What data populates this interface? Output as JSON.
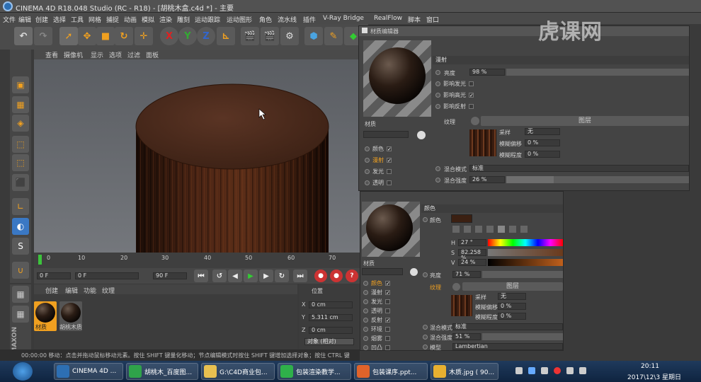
{
  "title": "CINEMA 4D R18.048 Studio (RC - R18) - [胡桃木盒.c4d *] - 主要",
  "menu": [
    "文件",
    "编辑",
    "创建",
    "选择",
    "工具",
    "网格",
    "捕捉",
    "动画",
    "模拟",
    "渲染",
    "雕刻",
    "运动跟踪",
    "运动图形",
    "角色",
    "流水线",
    "插件",
    "V-Ray Bridge",
    "RealFlow",
    "脚本",
    "窗口"
  ],
  "watermark": "虎课网",
  "viewport_menu": [
    "查看",
    "摄像机",
    "显示",
    "选项",
    "过滤",
    "面板"
  ],
  "timeline": {
    "ticks": [
      "0",
      "10",
      "20",
      "30",
      "40",
      "50",
      "60",
      "70"
    ],
    "start": "0 F",
    "min": "0 F",
    "max": "90 F",
    "end": "90 F"
  },
  "material_manager": {
    "menu": [
      "创建",
      "编辑",
      "功能",
      "纹理"
    ],
    "materials": [
      "材质",
      "胡桃木质"
    ]
  },
  "coords": {
    "header": "位置",
    "x": "0 cm",
    "y": "5.311 cm",
    "z": "0 cm",
    "mode": "对象 (相对)"
  },
  "status": "00:00:00    移动：点击并拖动鼠标移动元素。按住 SHIFT 键量化移动；节点编辑模式时按住 SHIFT 键增加选择对象；按住 CTRL 键",
  "editor1": {
    "title": "材质编辑器",
    "name": "材质",
    "channels": [
      {
        "label": "颜色",
        "checked": true
      },
      {
        "label": "漫射",
        "checked": true
      },
      {
        "label": "发光",
        "checked": false
      },
      {
        "label": "透明",
        "checked": false
      },
      {
        "label": "反射",
        "checked": true
      }
    ],
    "section": "漫射",
    "brightness_label": "亮度",
    "brightness": "98 %",
    "affect": [
      "影响发光",
      "影响高光",
      "影响反射"
    ],
    "texture_label": "纹理",
    "layer_button": "图层",
    "sampling_label": "采样",
    "sampling": "无",
    "blur_offset_label": "模糊偏移",
    "blur_offset": "0 %",
    "blur_scale_label": "模糊程度",
    "blur_scale": "0 %",
    "mix_mode_label": "混合模式",
    "mix_mode": "标准",
    "mix_strength_label": "混合强度",
    "mix_strength": "26 %"
  },
  "editor2": {
    "name": "材质",
    "section": "颜色",
    "color_label": "颜色",
    "channels": [
      {
        "label": "颜色",
        "checked": true
      },
      {
        "label": "漫射",
        "checked": true
      },
      {
        "label": "发光",
        "checked": false
      },
      {
        "label": "透明",
        "checked": false
      },
      {
        "label": "反射",
        "checked": true
      },
      {
        "label": "环境",
        "checked": false
      },
      {
        "label": "烟雾",
        "checked": false
      },
      {
        "label": "凹凸",
        "checked": false
      }
    ],
    "h": "27 °",
    "s": "82.258 %",
    "v": "24 %",
    "brightness_label": "亮度",
    "brightness": "71 %",
    "texture_label": "纹理",
    "layer_button": "图层",
    "sampling_label": "采样",
    "sampling": "无",
    "blur_offset_label": "模糊偏移",
    "blur_offset": "0 %",
    "blur_scale_label": "模糊程度",
    "blur_scale": "0 %",
    "mix_mode_label": "混合模式",
    "mix_mode": "标准",
    "mix_strength_label": "混合强度",
    "mix_strength": "51 %",
    "model_label": "模型",
    "model": "Lambertian"
  },
  "taskbar": {
    "items": [
      "CINEMA 4D ...",
      "胡桃木_百度图...",
      "G:\\C4D商业包...",
      "包装渲染教学...",
      "包装课序.ppt...",
      "木质.jpg ( 90..."
    ],
    "time": "20:11",
    "date": "2017\\12\\3 星期日"
  },
  "colors": {
    "accent": "#f0a020",
    "wood": "#3b2012"
  }
}
